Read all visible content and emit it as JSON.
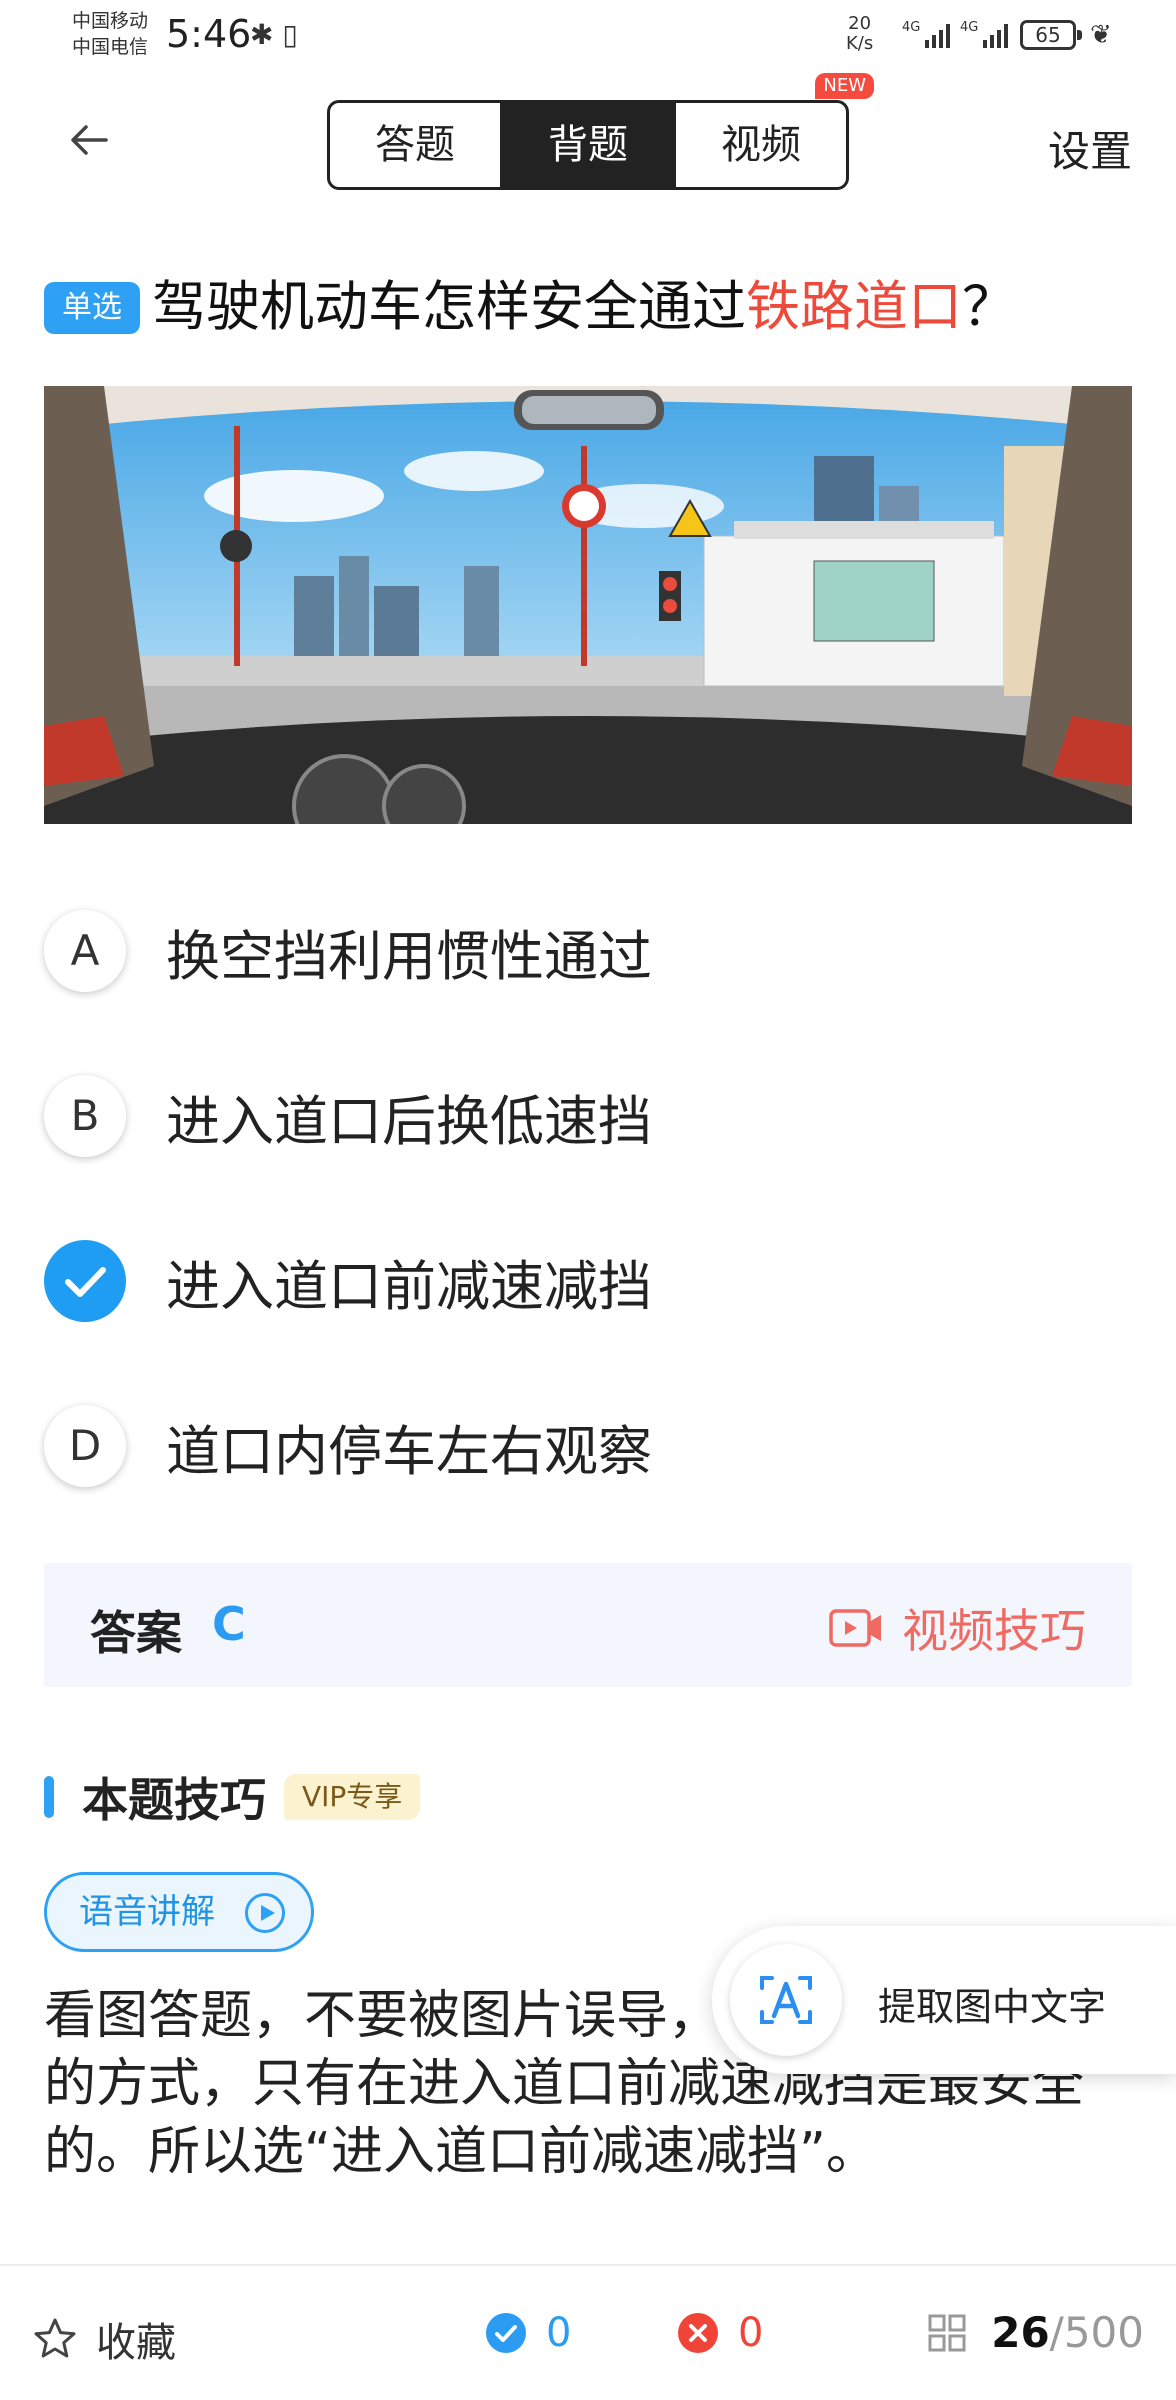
{
  "status_bar": {
    "carrier1": "中国移动",
    "carrier2": "中国电信",
    "time": "5:46",
    "net_speed_value": "20",
    "net_speed_unit": "K/s",
    "signal1_label": "4G",
    "signal2_label": "4G",
    "battery": "65"
  },
  "nav": {
    "back_icon": "arrow-left-icon",
    "tabs": [
      {
        "label": "答题",
        "active": false
      },
      {
        "label": "背题",
        "active": true
      },
      {
        "label": "视频",
        "active": false
      }
    ],
    "new_badge": "NEW",
    "settings_label": "设置"
  },
  "question": {
    "type_badge": "单选",
    "text_before": "驾驶机动车怎样安全通过",
    "text_highlight": "铁路道口",
    "text_after": "？",
    "highlight_color": "#ee4a3c"
  },
  "options": [
    {
      "letter": "A",
      "text": "换空挡利用惯性通过",
      "selected": false
    },
    {
      "letter": "B",
      "text": "进入道口后换低速挡",
      "selected": false
    },
    {
      "letter": "C",
      "text": "进入道口前减速减挡",
      "selected": true
    },
    {
      "letter": "D",
      "text": "道口内停车左右观察",
      "selected": false
    }
  ],
  "answer": {
    "label": "答案",
    "value": "C",
    "video_tip_label": "视频技巧"
  },
  "tips": {
    "title": "本题技巧",
    "vip_badge": "VIP专享",
    "voice_label": "语音讲解",
    "explanation": "看图答题，不要被图片误导，安全通过铁路道口的方式，只有在进入道口前减速减挡是最安全的。所以选“进入道口前减速减挡”。"
  },
  "ocr_chip": {
    "label": "提取图中文字"
  },
  "bottom_bar": {
    "favorite_label": "收藏",
    "correct_count": "0",
    "wrong_count": "0",
    "current": "26",
    "total": "/500"
  },
  "colors": {
    "accent": "#2ea1f5",
    "highlight_red": "#ee4a3c",
    "correct_blue": "#2b9cf2",
    "wrong_red": "#f04438"
  }
}
